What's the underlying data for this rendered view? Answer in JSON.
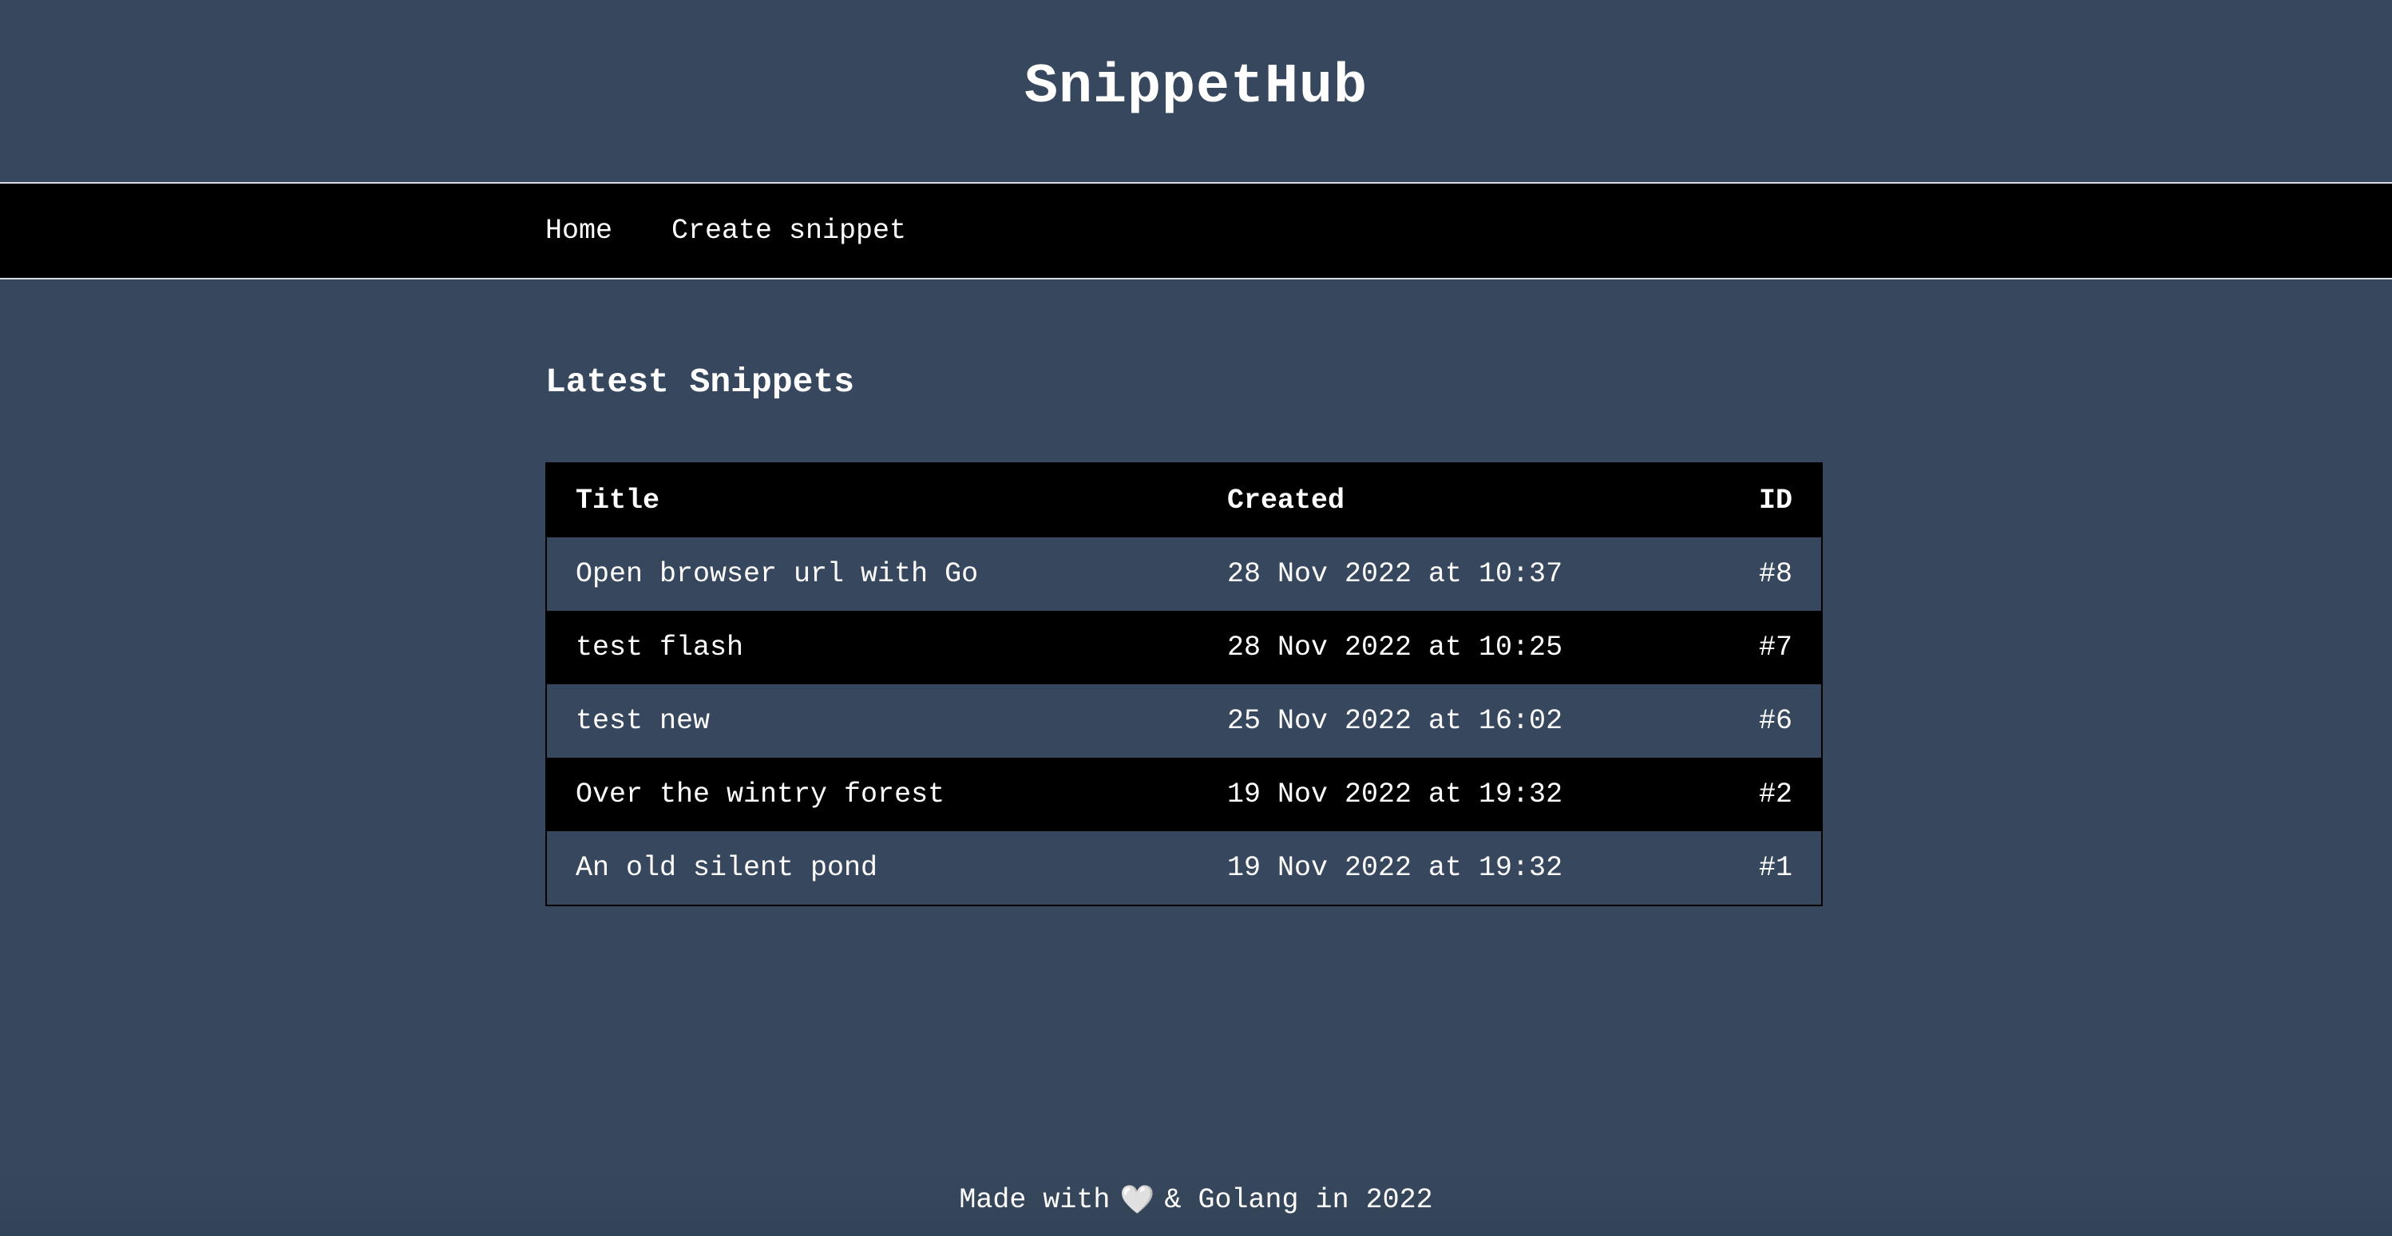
{
  "site": {
    "title": "SnippetHub"
  },
  "nav": {
    "items": [
      {
        "label": "Home"
      },
      {
        "label": "Create snippet"
      }
    ]
  },
  "main": {
    "heading": "Latest Snippets",
    "table": {
      "headers": {
        "title": "Title",
        "created": "Created",
        "id": "ID"
      },
      "rows": [
        {
          "title": "Open browser url with Go",
          "created": "28 Nov 2022 at 10:37",
          "id": "#8"
        },
        {
          "title": "test flash",
          "created": "28 Nov 2022 at 10:25",
          "id": "#7"
        },
        {
          "title": "test new",
          "created": "25 Nov 2022 at 16:02",
          "id": "#6"
        },
        {
          "title": "Over the wintry forest",
          "created": "19 Nov 2022 at 19:32",
          "id": "#2"
        },
        {
          "title": "An old silent pond",
          "created": "19 Nov 2022 at 19:32",
          "id": "#1"
        }
      ]
    }
  },
  "footer": {
    "prefix": "Made with",
    "heart": "🤍",
    "suffix": "& Golang in 2022",
    "heart_icon": "heart-icon"
  },
  "colors": {
    "background": "#37485e",
    "nav_background": "#000000",
    "text": "#ffffff",
    "table_alt_row": "#000000"
  }
}
